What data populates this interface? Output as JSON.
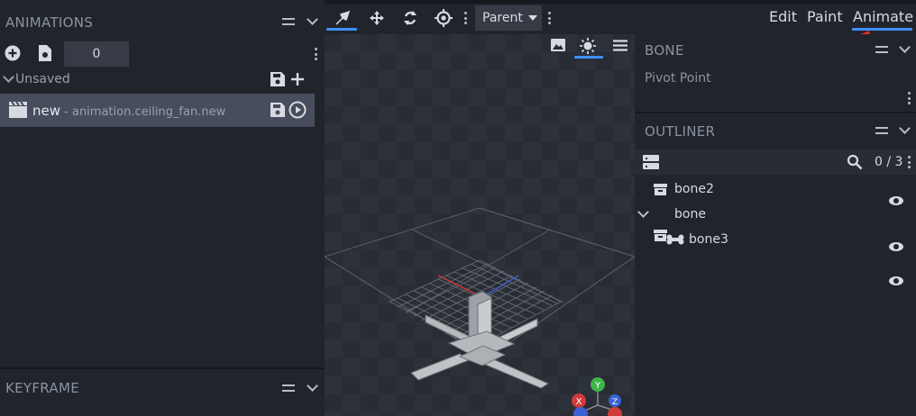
{
  "animations_panel": {
    "title": "ANIMATIONS",
    "time_value": "0",
    "group_label": "Unsaved",
    "item_name": "new",
    "item_file": " - animation.ceiling_fan.new"
  },
  "keyframe_panel": {
    "title": "KEYFRAME"
  },
  "toolbar": {
    "pivot_mode": "Parent",
    "modes": [
      "Edit",
      "Paint",
      "Animate"
    ],
    "active_mode": "Animate"
  },
  "bone_panel": {
    "title": "BONE",
    "pivot_label": "Pivot Point"
  },
  "outliner": {
    "title": "OUTLINER",
    "count": "0 / 3",
    "items": [
      {
        "name": "bone2",
        "type": "group",
        "visible": true
      },
      {
        "name": "bone",
        "type": "group",
        "expanded": true,
        "visible": true
      },
      {
        "name": "bone3",
        "type": "bone",
        "visible": true
      }
    ]
  },
  "colors": {
    "accent": "#3e90ff",
    "panel_bg": "#21252b",
    "header_bg": "#282c34",
    "selected_row": "#474d5d",
    "annotation_arrow": "#e02a2a"
  },
  "gizmo": {
    "axes": [
      "X",
      "Y",
      "Z"
    ]
  }
}
